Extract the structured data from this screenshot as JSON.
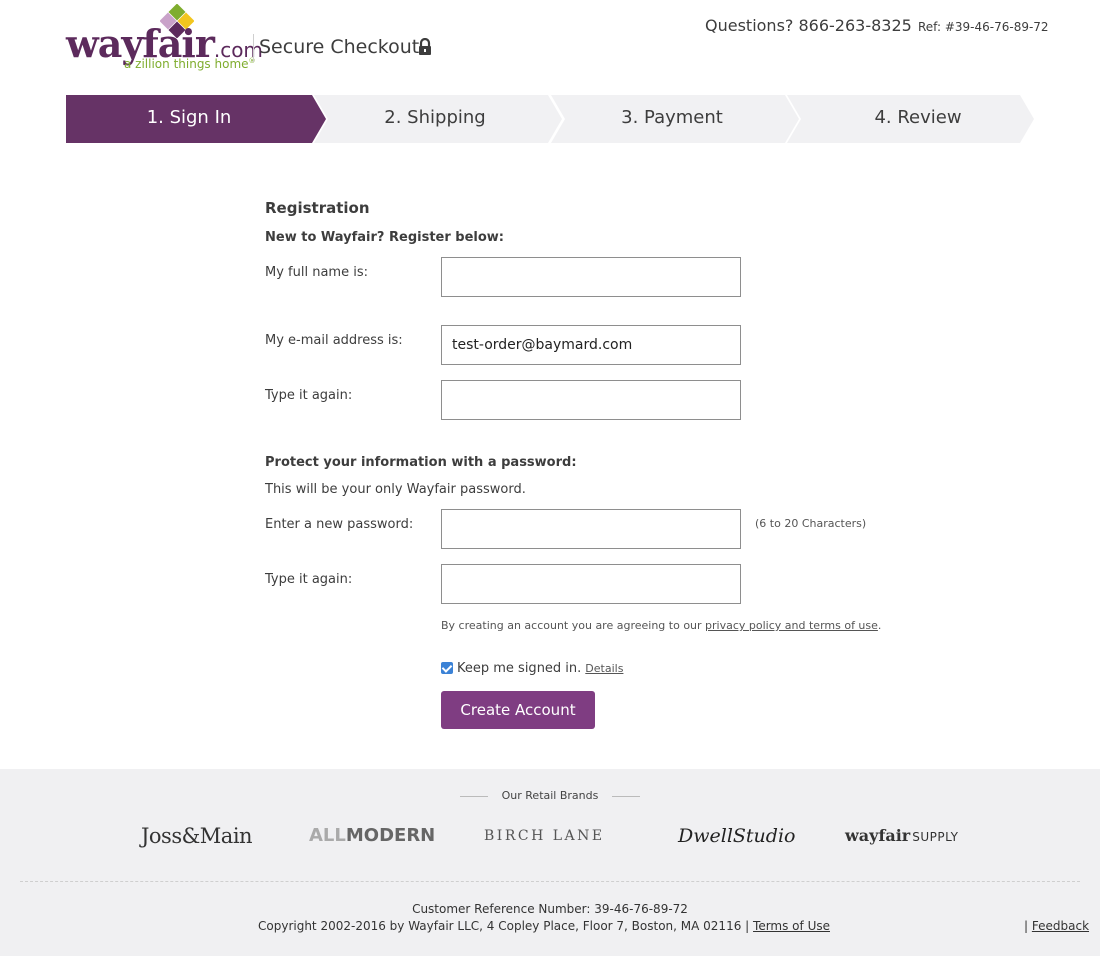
{
  "header": {
    "logo_word": "wayfair",
    "logo_com": ".com",
    "logo_tagline": "a zillion things home",
    "logo_registered": "®",
    "secure_checkout": "Secure Checkout",
    "questions": "Questions? 866-263-8325",
    "ref": "Ref: #39-46-76-89-72"
  },
  "steps": [
    {
      "label": "1. Sign In",
      "active": true
    },
    {
      "label": "2. Shipping",
      "active": false
    },
    {
      "label": "3. Payment",
      "active": false
    },
    {
      "label": "4. Review",
      "active": false
    }
  ],
  "form": {
    "heading": "Registration",
    "new_prompt": "New to Wayfair? Register below:",
    "full_name_label": "My full name is:",
    "full_name_value": "",
    "email_label": "My e-mail address is:",
    "email_value": "test-order@baymard.com",
    "email_again_label": "Type it again:",
    "email_again_value": "",
    "password_heading": "Protect your information with a password:",
    "password_note": "This will be your only Wayfair password.",
    "password_label": "Enter a new password:",
    "password_hint": "(6 to 20 Characters)",
    "password_again_label": "Type it again:",
    "agree_text": "By creating an account you are agreeing to our",
    "agree_link": "privacy policy and terms of use",
    "agree_end": ".",
    "keep_signed_in": "Keep me signed in.",
    "keep_signed_in_checked": true,
    "details_link": "Details",
    "create_button": "Create Account"
  },
  "footer": {
    "brands_title": "Our Retail Brands",
    "brands": {
      "joss": "Joss&Main",
      "allmodern_all": "ALL",
      "allmodern_modern": "MODERN",
      "birch": "BIRCH LANE",
      "dwell": "DwellStudio",
      "supply_word": "wayfair",
      "supply_suffix": "SUPPLY"
    },
    "customer_ref": "Customer Reference Number:  39-46-76-89-72",
    "copyright": "Copyright 2002-2016 by Wayfair LLC, 4 Copley Place, Floor 7, Boston, MA 02116 |",
    "terms_link": "Terms of Use",
    "feedback_sep": "|",
    "feedback_link": "Feedback"
  },
  "colors": {
    "brand_purple": "#5c2a5c",
    "active_step": "#663366",
    "inactive_step": "#f1f1f3",
    "button": "#7f3d82",
    "tagline_green": "#7fad2e"
  },
  "icons": {
    "lock": "lock-icon",
    "logo_mark": "wayfair-pinwheel-icon",
    "checkbox": "checkbox-checked-icon"
  }
}
